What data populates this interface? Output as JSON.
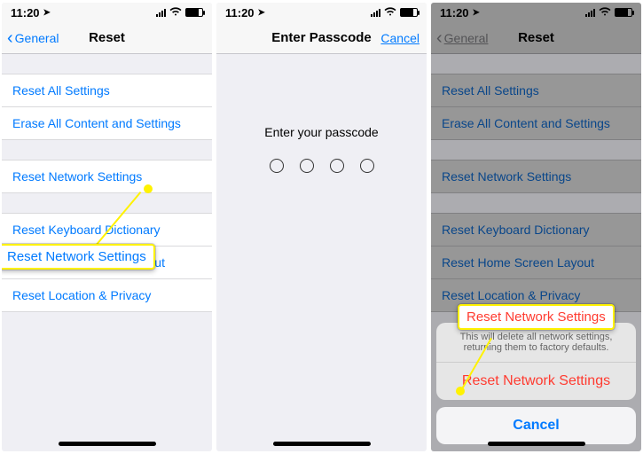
{
  "status": {
    "time": "11:20",
    "loc_glyph": "➤"
  },
  "screen1": {
    "back": "General",
    "title": "Reset",
    "group1": [
      "Reset All Settings",
      "Erase All Content and Settings"
    ],
    "row_network": "Reset Network Settings",
    "group2": [
      "Reset Keyboard Dictionary",
      "Reset Home Screen Layout",
      "Reset Location & Privacy"
    ],
    "callout": "Reset Network Settings"
  },
  "screen2": {
    "title": "Enter Passcode",
    "cancel": "Cancel",
    "prompt": "Enter your passcode"
  },
  "screen3": {
    "back": "General",
    "title": "Reset",
    "group1": [
      "Reset All Settings",
      "Erase All Content and Settings"
    ],
    "row_network": "Reset Network Settings",
    "group2": [
      "Reset Keyboard Dictionary",
      "Reset Home Screen Layout",
      "Reset Location & Privacy"
    ],
    "sheet_msg": "This will delete all network settings, returning them to factory defaults.",
    "sheet_action": "Reset Network Settings",
    "sheet_cancel": "Cancel",
    "callout": "Reset Network Settings"
  }
}
